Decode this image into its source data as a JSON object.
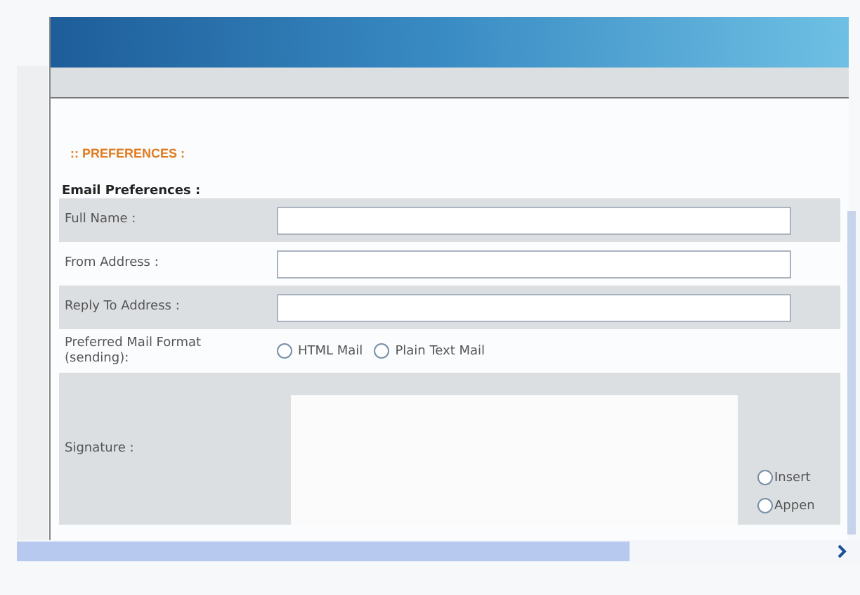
{
  "section_title": ":: PREFERENCES :",
  "group_title": "Email Preferences :",
  "fields": [
    {
      "kind": "text",
      "label": "Full Name :"
    },
    {
      "kind": "text",
      "label": "From Address :"
    },
    {
      "kind": "text",
      "label": "Reply To Address :"
    },
    {
      "kind": "radio",
      "label": "Preferred Mail Format (sending):",
      "options": [
        {
          "label": "HTML Mail",
          "selected": false
        },
        {
          "label": "Plain Text Mail",
          "selected": false
        }
      ]
    },
    {
      "kind": "textarea",
      "label": "Signature :",
      "options": [
        {
          "label": "Insert",
          "selected": false
        },
        {
          "label": "Appen",
          "selected": false
        }
      ]
    }
  ]
}
